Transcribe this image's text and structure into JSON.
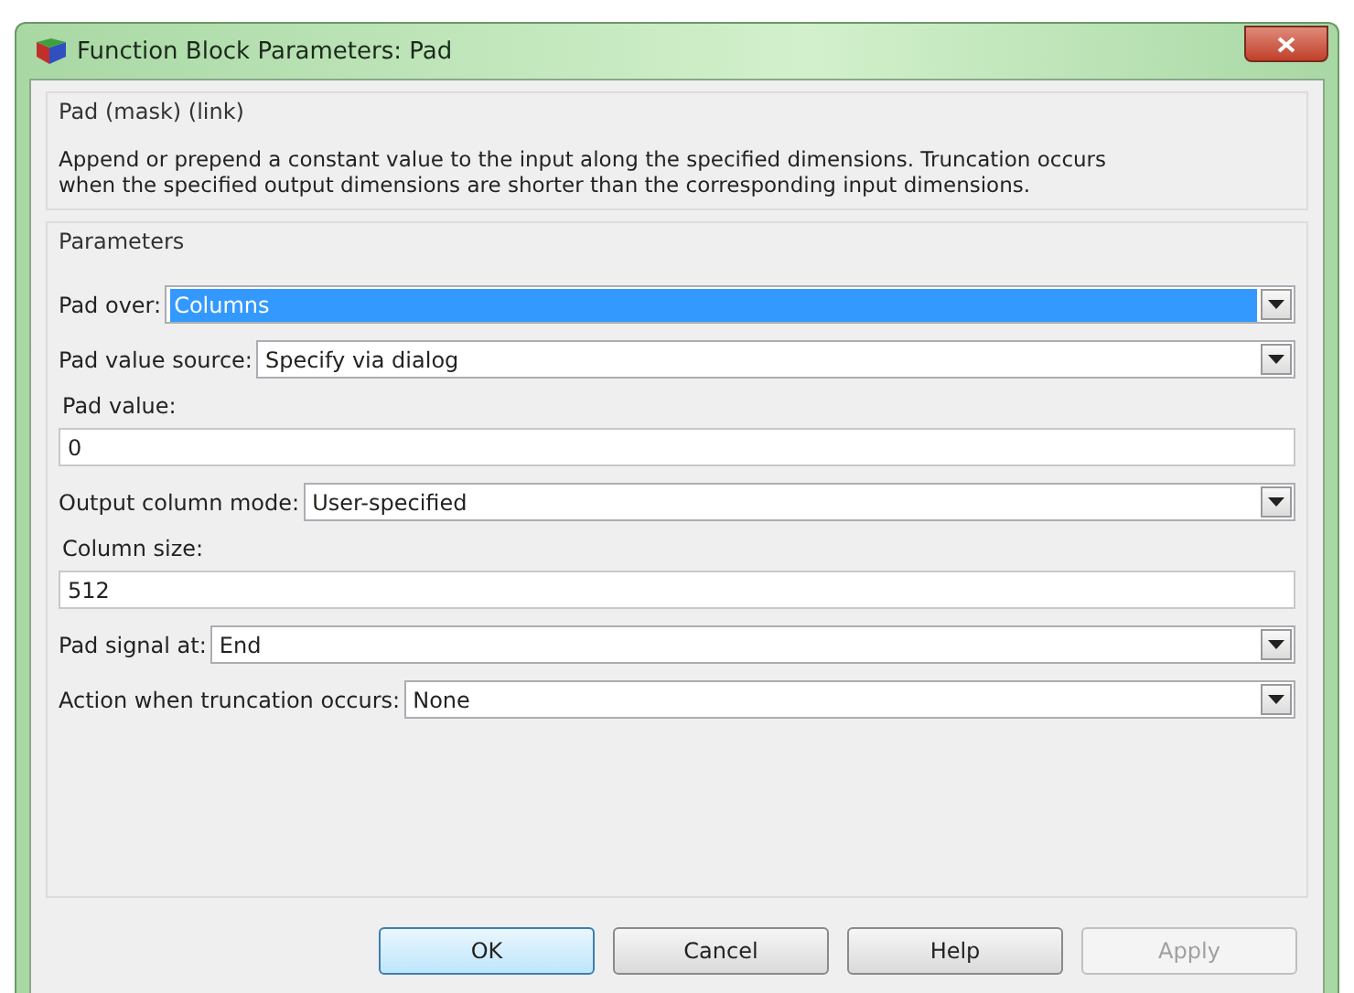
{
  "window": {
    "title": "Function Block Parameters: Pad"
  },
  "description": {
    "title": "Pad (mask) (link)",
    "text": "Append or prepend a constant value to the input along the specified dimensions. Truncation occurs when the specified output dimensions are shorter than the corresponding input dimensions."
  },
  "parameters": {
    "title": "Parameters",
    "rows": [
      {
        "kind": "dropdown",
        "label": "Pad over:",
        "value": "Columns",
        "selected": true
      },
      {
        "kind": "dropdown",
        "label": "Pad value source:",
        "value": "Specify via dialog",
        "selected": false
      },
      {
        "kind": "edit",
        "label": "Pad value:",
        "value": "0"
      },
      {
        "kind": "dropdown",
        "label": "Output column mode:",
        "value": "User-specified",
        "selected": false
      },
      {
        "kind": "edit",
        "label": "Column size:",
        "value": "512"
      },
      {
        "kind": "dropdown",
        "label": "Pad signal at:",
        "value": "End",
        "selected": false
      },
      {
        "kind": "dropdown",
        "label": "Action when truncation occurs:",
        "value": "None",
        "selected": false
      }
    ]
  },
  "buttons": [
    {
      "label": "OK",
      "disabled": false,
      "default": true
    },
    {
      "label": "Cancel",
      "disabled": false,
      "default": false
    },
    {
      "label": "Help",
      "disabled": false,
      "default": false
    },
    {
      "label": "Apply",
      "disabled": true,
      "default": false
    }
  ]
}
